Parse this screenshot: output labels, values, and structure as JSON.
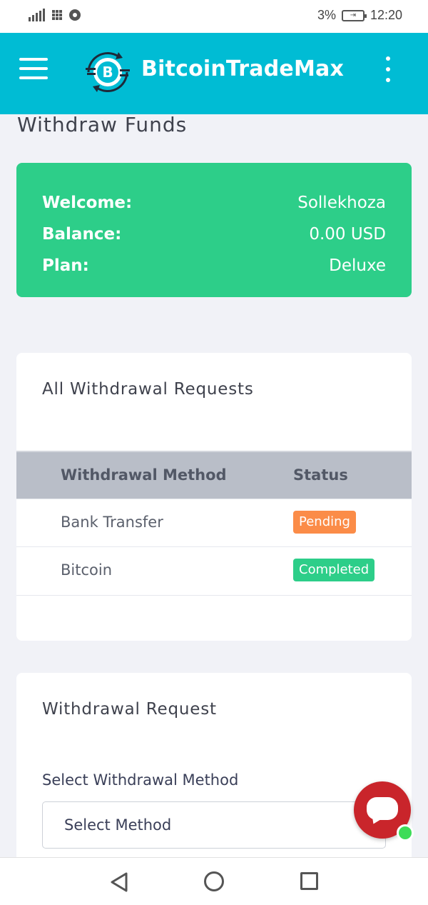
{
  "status_bar": {
    "battery_percent": "3%",
    "time": "12:20"
  },
  "header": {
    "app_name": "BitcoinTradeMax",
    "accent_color": "#00bcd4",
    "logo_icon": "bitcoin-exchange-icon"
  },
  "page": {
    "title": "Withdraw Funds"
  },
  "account_summary": {
    "background_color": "#2dce89",
    "rows": [
      {
        "label": "Welcome:",
        "value": "Sollekhoza"
      },
      {
        "label": "Balance:",
        "value": "0.00 USD"
      },
      {
        "label": "Plan:",
        "value": "Deluxe"
      }
    ]
  },
  "withdrawal_requests": {
    "title": "All Withdrawal Requests",
    "columns": [
      "Withdrawal Method",
      "Status"
    ],
    "rows": [
      {
        "method": "Bank Transfer",
        "status": "Pending",
        "status_color": "#fb8c48"
      },
      {
        "method": "Bitcoin",
        "status": "Completed",
        "status_color": "#2dce89"
      }
    ]
  },
  "withdrawal_form": {
    "title": "Withdrawal Request",
    "method_label": "Select Withdrawal Method",
    "method_select_value": "Select Method"
  },
  "chat_widget": {
    "icon": "chat-bubble-icon",
    "color": "#c9252b",
    "online_color": "#3ddc58"
  },
  "system_nav": {
    "icons": [
      "back-icon",
      "home-icon",
      "recent-apps-icon"
    ]
  }
}
